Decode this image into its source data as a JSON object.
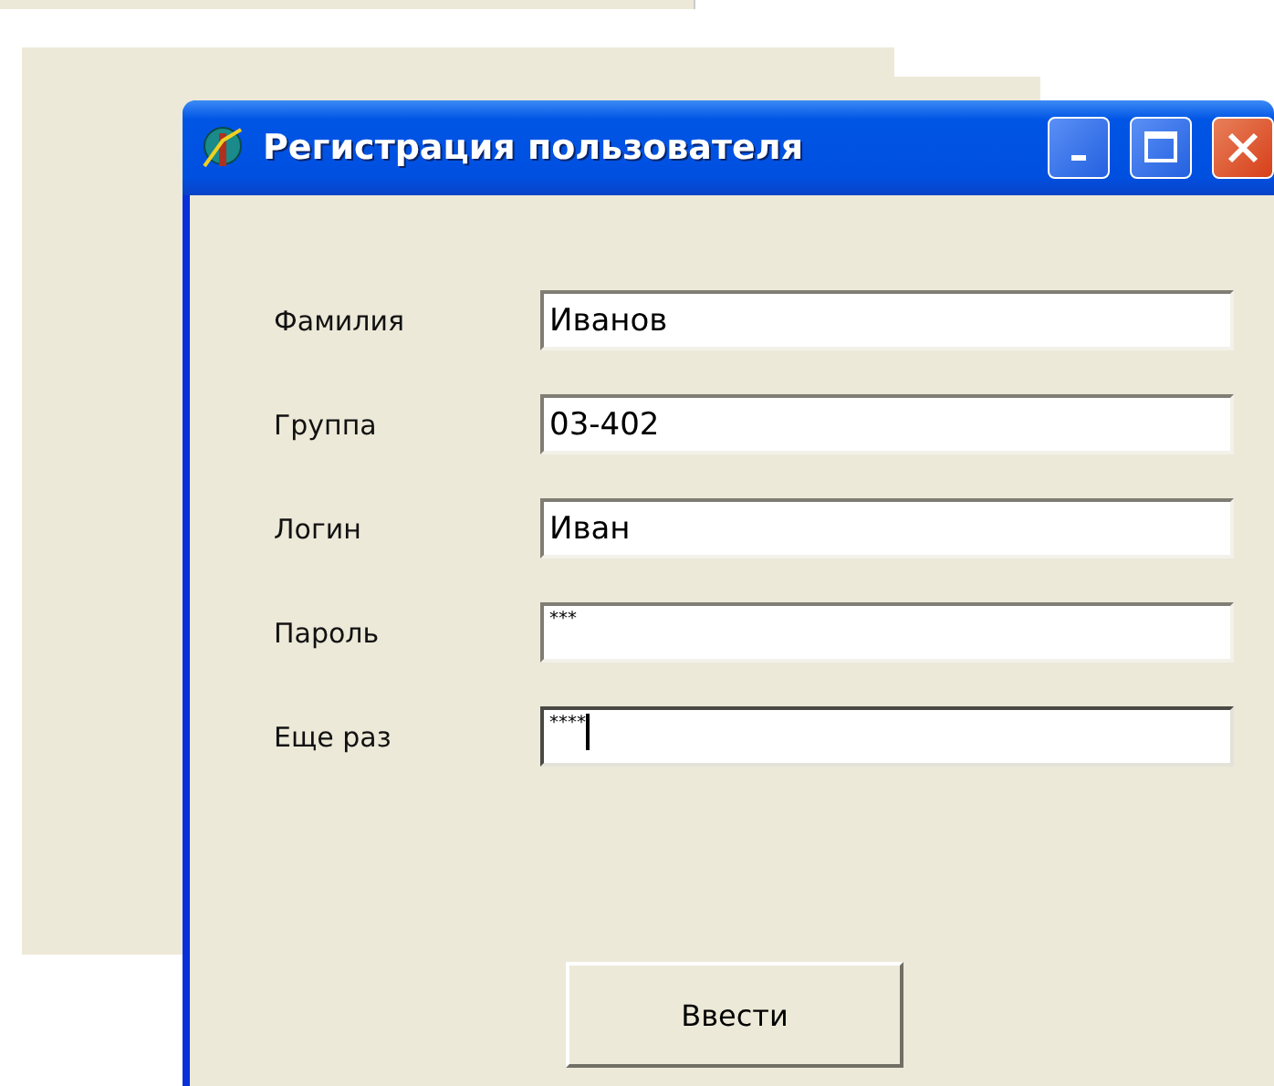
{
  "window": {
    "title": "Регистрация пользователя"
  },
  "fields": [
    {
      "label": "Фамилия",
      "value": "Иванов",
      "kind": "text",
      "focused": false
    },
    {
      "label": "Группа",
      "value": "03-402",
      "kind": "text",
      "focused": false
    },
    {
      "label": "Логин",
      "value": "Иван",
      "kind": "text",
      "focused": false
    },
    {
      "label": "Пароль",
      "value": "***",
      "kind": "password",
      "focused": false
    },
    {
      "label": "Еще раз",
      "value": "****",
      "kind": "password",
      "focused": true
    }
  ],
  "buttons": [
    "Ввести"
  ]
}
